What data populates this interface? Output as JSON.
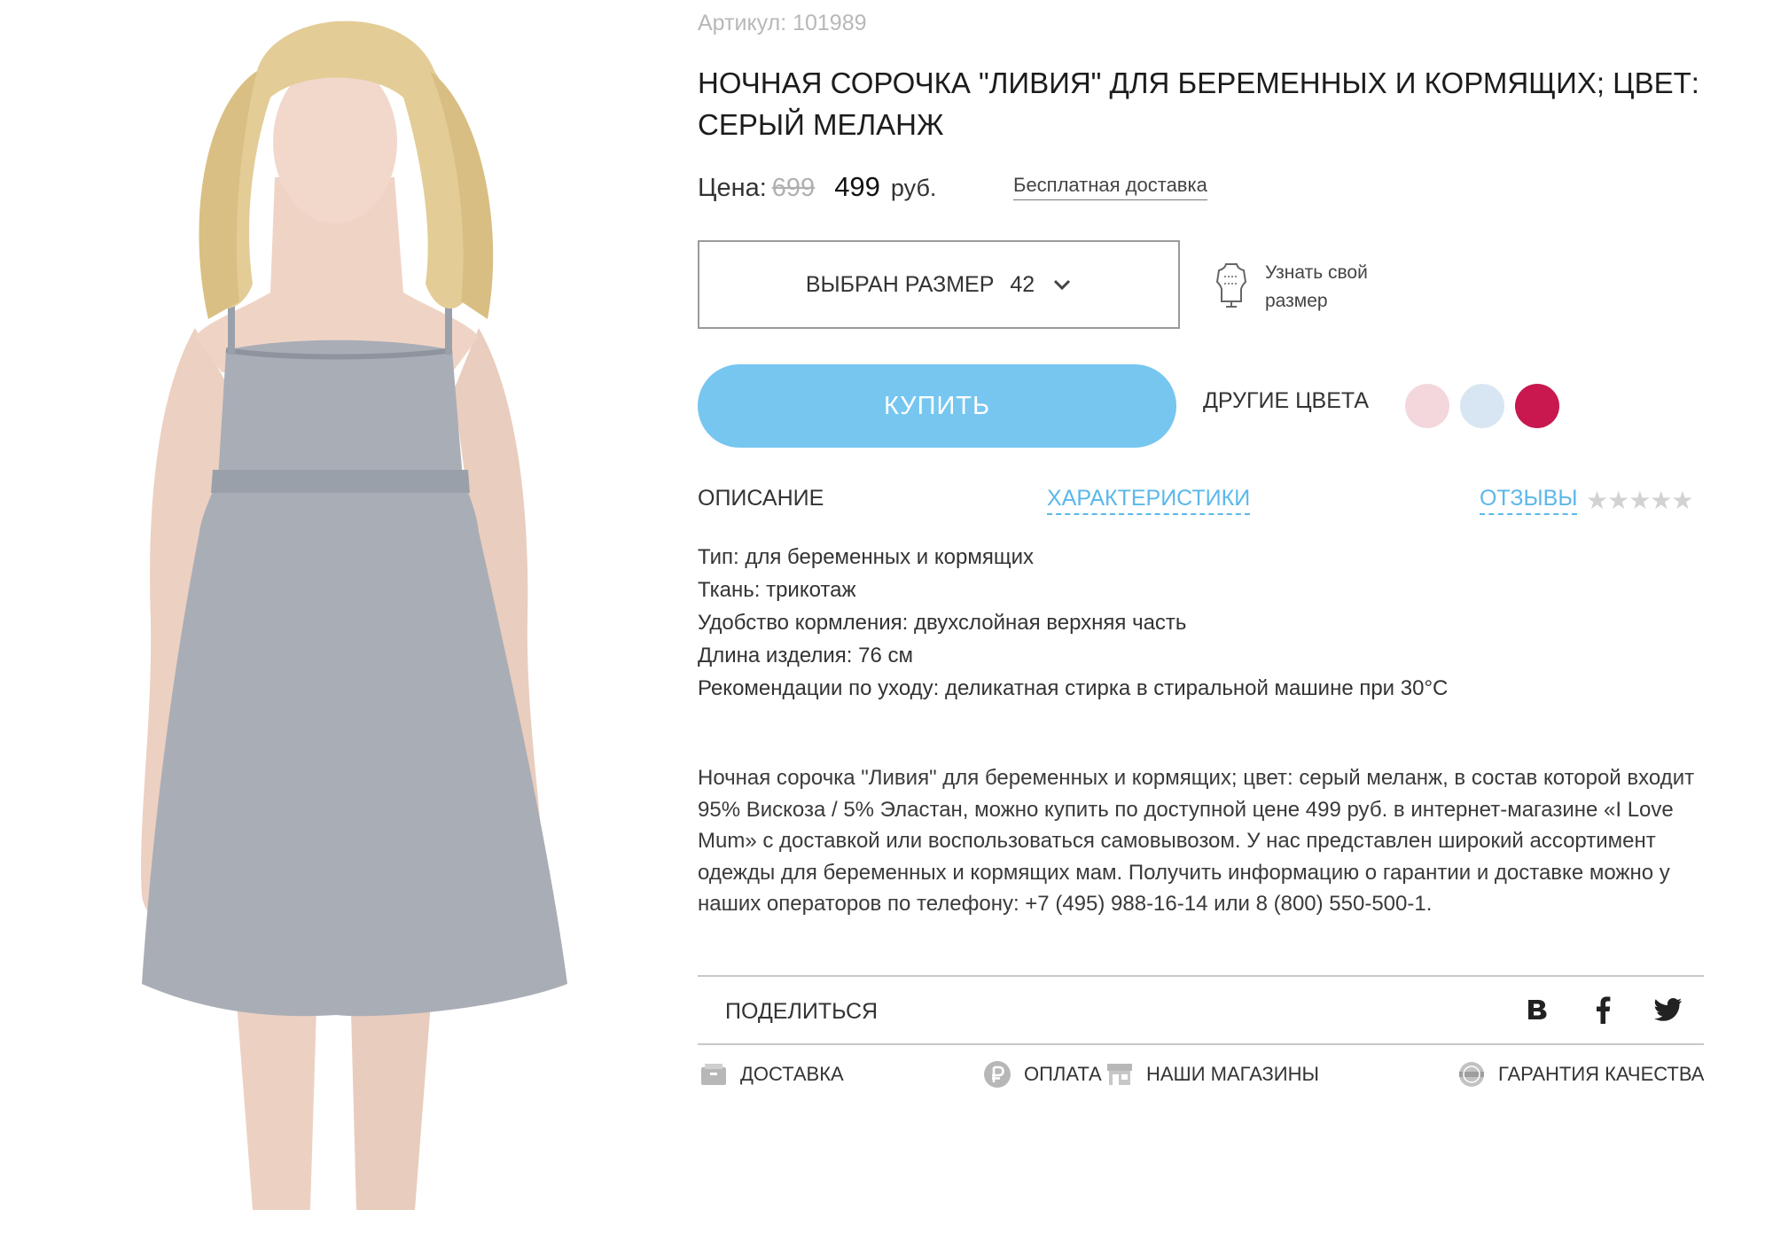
{
  "product": {
    "sku": "Артикул: 101989",
    "title": "НОЧНАЯ СОРОЧКА \"ЛИВИЯ\" ДЛЯ БЕРЕМЕННЫХ И КОРМЯЩИХ; ЦВЕТ: СЕРЫЙ МЕЛАНЖ",
    "image_icon": "product-photo"
  },
  "price": {
    "label": "Цена:",
    "old": "699",
    "current": "499",
    "currency": "руб.",
    "free_delivery": "Бесплатная доставка"
  },
  "size": {
    "label": "ВЫБРАН РАЗМЕР",
    "value": "42",
    "guide": "Узнать свой размер",
    "guide_icon": "mannequin-icon"
  },
  "buy": {
    "label": "КУПИТЬ",
    "color": "#76c6f0"
  },
  "colors": {
    "label": "ДРУГИЕ ЦВЕТА",
    "swatches": [
      {
        "name": "pink",
        "color": "#f3d7dd"
      },
      {
        "name": "light-blue",
        "color": "#d8e6f3"
      },
      {
        "name": "crimson",
        "color": "#c8184f"
      }
    ]
  },
  "tabs": [
    {
      "label": "ОПИСАНИЕ",
      "active": true
    },
    {
      "label": "ХАРАКТЕРИСТИКИ",
      "active": false
    },
    {
      "label": "ОТЗЫВЫ",
      "active": false
    }
  ],
  "rating": {
    "stars": "★★★★★",
    "value": 0,
    "max": 5
  },
  "specs": [
    "Тип: для беременных и кормящих",
    "Ткань: трикотаж",
    "Удобство кормления: двухслойная верхняя часть",
    "Длина изделия: 76 см",
    "Рекомендации по уходу: деликатная стирка в стиральной машине при 30°С"
  ],
  "description": "Ночная сорочка \"Ливия\" для беременных и кормящих; цвет: серый меланж, в состав которой входит 95% Вискоза / 5% Эластан, можно купить по доступной цене 499 руб. в интернет-магазине «I Love Mum» с доставкой или воспользоваться самовывозом. У нас представлен широкий ассортимент одежды для беременных и кормящих мам. Получить информацию о гарантии и доставке можно у наших операторов по телефону: +7 (495) 988-16-14 или 8 (800) 550-500-1.",
  "share": {
    "label": "ПОДЕЛИТЬСЯ",
    "icons": [
      "vk-icon",
      "facebook-icon",
      "twitter-icon"
    ]
  },
  "footer": [
    {
      "label": "ДОСТАВКА",
      "icon": "delivery-icon"
    },
    {
      "label": "ОПЛАТА",
      "icon": "ruble-icon"
    },
    {
      "label": "НАШИ МАГАЗИНЫ",
      "icon": "store-icon"
    },
    {
      "label": "ГАРАНТИЯ КАЧЕСТВА",
      "icon": "quality-badge-icon"
    }
  ]
}
